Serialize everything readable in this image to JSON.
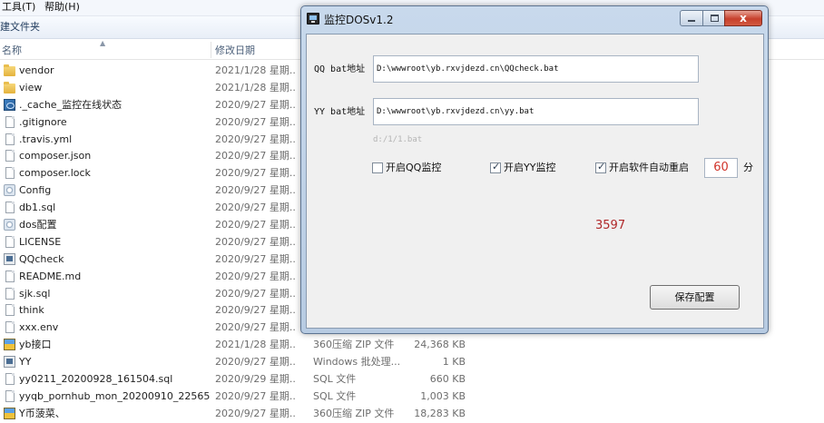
{
  "explorer": {
    "menu": {
      "tools": "工具(T)",
      "help": "帮助(H)"
    },
    "toolbar": {
      "new_folder": "建文件夹"
    },
    "columns": {
      "name": "名称",
      "date": "修改日期"
    },
    "rows": [
      {
        "name": "vendor",
        "date": "2021/1/28 星期...",
        "type": "",
        "size": "",
        "icon": "folder-icon"
      },
      {
        "name": "view",
        "date": "2021/1/28 星期...",
        "type": "",
        "size": "",
        "icon": "folder-icon"
      },
      {
        "name": "._cache_监控在线状态",
        "date": "2020/9/27 星期...",
        "type": "",
        "size": "",
        "icon": "cache-icon"
      },
      {
        "name": ".gitignore",
        "date": "2020/9/27 星期...",
        "type": "",
        "size": "",
        "icon": "file-icon"
      },
      {
        "name": ".travis.yml",
        "date": "2020/9/27 星期...",
        "type": "",
        "size": "",
        "icon": "file-icon"
      },
      {
        "name": "composer.json",
        "date": "2020/9/27 星期...",
        "type": "",
        "size": "",
        "icon": "file-icon"
      },
      {
        "name": "composer.lock",
        "date": "2020/9/27 星期...",
        "type": "",
        "size": "",
        "icon": "file-icon"
      },
      {
        "name": "Config",
        "date": "2020/9/27 星期...",
        "type": "",
        "size": "",
        "icon": "config-icon"
      },
      {
        "name": "db1.sql",
        "date": "2020/9/27 星期...",
        "type": "",
        "size": "",
        "icon": "file-icon"
      },
      {
        "name": "dos配置",
        "date": "2020/9/27 星期...",
        "type": "",
        "size": "",
        "icon": "config-icon"
      },
      {
        "name": "LICENSE",
        "date": "2020/9/27 星期...",
        "type": "",
        "size": "",
        "icon": "file-icon"
      },
      {
        "name": "QQcheck",
        "date": "2020/9/27 星期...",
        "type": "",
        "size": "",
        "icon": "batch-icon"
      },
      {
        "name": "README.md",
        "date": "2020/9/27 星期...",
        "type": "",
        "size": "",
        "icon": "file-icon"
      },
      {
        "name": "sjk.sql",
        "date": "2020/9/27 星期...",
        "type": "",
        "size": "",
        "icon": "file-icon"
      },
      {
        "name": "think",
        "date": "2020/9/27 星期...",
        "type": "",
        "size": "",
        "icon": "file-icon"
      },
      {
        "name": "xxx.env",
        "date": "2020/9/27 星期...",
        "type": "",
        "size": "",
        "icon": "file-icon"
      },
      {
        "name": "yb接口",
        "date": "2021/1/28 星期...",
        "type": "360压缩 ZIP 文件",
        "size": "24,368 KB",
        "icon": "zip-icon"
      },
      {
        "name": "YY",
        "date": "2020/9/27 星期...",
        "type": "Windows 批处理...",
        "size": "1 KB",
        "icon": "batch-icon"
      },
      {
        "name": "yy0211_20200928_161504.sql",
        "date": "2020/9/29 星期...",
        "type": "SQL 文件",
        "size": "660 KB",
        "icon": "file-icon"
      },
      {
        "name": "yyqb_pornhub_mon_20200910_22565...",
        "date": "2020/9/27 星期...",
        "type": "SQL 文件",
        "size": "1,003 KB",
        "icon": "file-icon"
      },
      {
        "name": "Y币菠菜、",
        "date": "2020/9/27 星期...",
        "type": "360压缩 ZIP 文件",
        "size": "18,283 KB",
        "icon": "zip-icon"
      }
    ]
  },
  "dialog": {
    "title": "监控DOSv1.2",
    "qq_label": "QQ bat地址",
    "qq_path": "D:\\wwwroot\\yb.rxvjdezd.cn\\QQcheck.bat",
    "yy_label": "YY bat地址",
    "yy_path": "D:\\wwwroot\\yb.rxvjdezd.cn\\yy.bat",
    "hint": "d:/1/1.bat",
    "qq_monitor": {
      "label": "开启QQ监控",
      "checked": false
    },
    "yy_monitor": {
      "label": "开启YY监控",
      "checked": true
    },
    "auto_restart": {
      "label": "开启软件自动重启",
      "checked": true
    },
    "restart_minutes": "60",
    "minutes_unit": "分",
    "counter": "3597",
    "save_label": "保存配置",
    "close_glyph": "x"
  }
}
